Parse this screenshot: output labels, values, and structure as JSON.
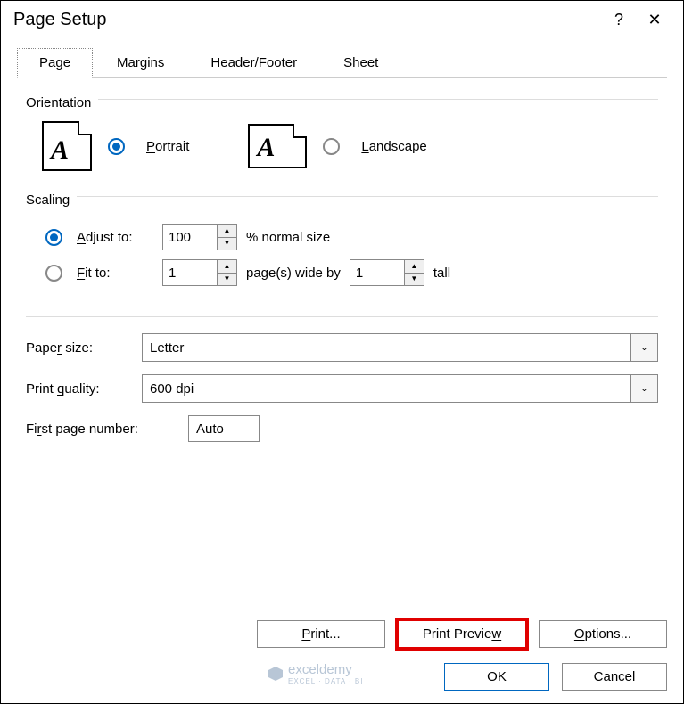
{
  "title": "Page Setup",
  "tabs": [
    "Page",
    "Margins",
    "Header/Footer",
    "Sheet"
  ],
  "orientation": {
    "label": "Orientation",
    "portrait": "Portrait",
    "landscape": "Landscape"
  },
  "scaling": {
    "label": "Scaling",
    "adjust_to": "Adjust to:",
    "adjust_value": "100",
    "adjust_suffix": "% normal size",
    "fit_to": "Fit to:",
    "fit_wide": "1",
    "fit_mid": "page(s) wide by",
    "fit_tall_val": "1",
    "fit_tall_suffix": "tall"
  },
  "paper": {
    "label": "Paper size:",
    "value": "Letter"
  },
  "quality": {
    "label": "Print quality:",
    "value": "600 dpi"
  },
  "first_page": {
    "label": "First page number:",
    "value": "Auto"
  },
  "buttons": {
    "print": "Print...",
    "preview": "Print Preview",
    "options": "Options...",
    "ok": "OK",
    "cancel": "Cancel"
  },
  "watermark": {
    "brand": "exceldemy",
    "sub": "EXCEL · DATA · BI"
  }
}
